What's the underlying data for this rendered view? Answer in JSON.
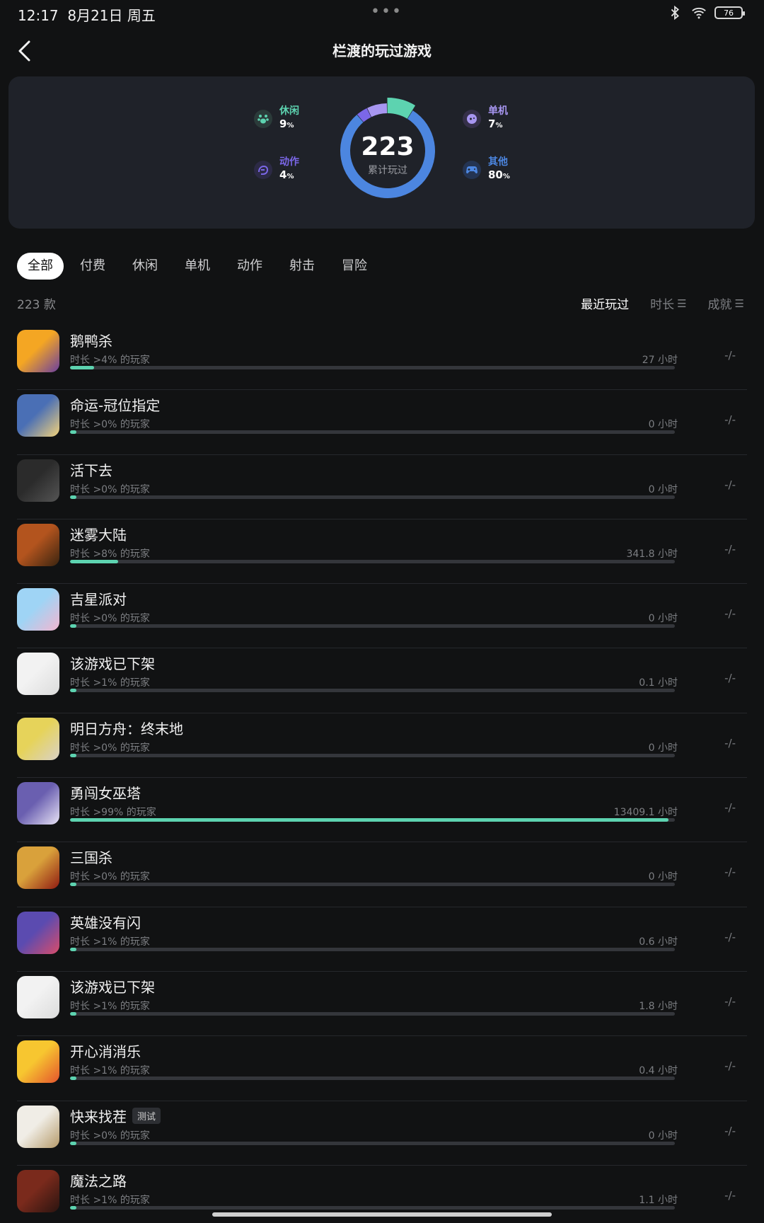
{
  "status_bar": {
    "time": "12:17",
    "date": "8月21日 周五",
    "battery": "76",
    "dots": "•••"
  },
  "header": {
    "title": "栏渡的玩过游戏",
    "back_icon": "chevron-left-icon"
  },
  "summary": {
    "total": "223",
    "total_label": "累计玩过",
    "categories": [
      {
        "name": "休闲",
        "percent": "9",
        "unit": "%",
        "color": "#5dd3b0",
        "icon": "paw-icon"
      },
      {
        "name": "动作",
        "percent": "4",
        "unit": "%",
        "color": "#7b67e8",
        "icon": "punch-icon"
      },
      {
        "name": "单机",
        "percent": "7",
        "unit": "%",
        "color": "#a796f0",
        "icon": "gamepad-icon"
      },
      {
        "name": "其他",
        "percent": "80",
        "unit": "%",
        "color": "#4c86e0",
        "icon": "controller-icon"
      }
    ]
  },
  "tabs": [
    "全部",
    "付费",
    "休闲",
    "单机",
    "动作",
    "射击",
    "冒险"
  ],
  "list_header": {
    "count": "223 款",
    "sort": [
      "最近玩过",
      "时长",
      "成就"
    ],
    "sort_glyph": "☰"
  },
  "games": [
    {
      "name": "鹅鸭杀",
      "sub": "时长 >4% 的玩家",
      "hours": "27 小时",
      "progress": 0.04,
      "ach": "-/-",
      "icon_colors": [
        "#f4a623",
        "#6b3fa0"
      ]
    },
    {
      "name": "命运-冠位指定",
      "sub": "时长 >0% 的玩家",
      "hours": "0 小时",
      "progress": 0.0,
      "ach": "-/-",
      "icon_colors": [
        "#4a6fb5",
        "#f2d27a"
      ]
    },
    {
      "name": "活下去",
      "sub": "时长 >0% 的玩家",
      "hours": "0 小时",
      "progress": 0.0,
      "ach": "-/-",
      "icon_colors": [
        "#2b2b2b",
        "#555555"
      ]
    },
    {
      "name": "迷雾大陆",
      "sub": "时长 >8% 的玩家",
      "hours": "341.8 小时",
      "progress": 0.08,
      "ach": "-/-",
      "icon_colors": [
        "#b3541e",
        "#3a2410"
      ]
    },
    {
      "name": "吉星派对",
      "sub": "时长 >0% 的玩家",
      "hours": "0 小时",
      "progress": 0.0,
      "ach": "-/-",
      "icon_colors": [
        "#9fd4f5",
        "#f3b6d0"
      ]
    },
    {
      "name": "该游戏已下架",
      "sub": "时长 >1% 的玩家",
      "hours": "0.1 小时",
      "progress": 0.01,
      "ach": "-/-",
      "icon_colors": [
        "#f2f2f2",
        "#dcdcdc"
      ]
    },
    {
      "name": "明日方舟：终末地",
      "sub": "时长 >0% 的玩家",
      "hours": "0 小时",
      "progress": 0.0,
      "ach": "-/-",
      "icon_colors": [
        "#e6d35a",
        "#d9d2c7"
      ]
    },
    {
      "name": "勇闯女巫塔",
      "sub": "时长 >99% 的玩家",
      "hours": "13409.1 小时",
      "progress": 0.99,
      "ach": "-/-",
      "icon_colors": [
        "#6a5fb0",
        "#e8e3f5"
      ]
    },
    {
      "name": "三国杀",
      "sub": "时长 >0% 的玩家",
      "hours": "0 小时",
      "progress": 0.0,
      "ach": "-/-",
      "icon_colors": [
        "#d9a13b",
        "#8f1b12"
      ]
    },
    {
      "name": "英雄没有闪",
      "sub": "时长 >1% 的玩家",
      "hours": "0.6 小时",
      "progress": 0.01,
      "ach": "-/-",
      "icon_colors": [
        "#5b4bb0",
        "#d94d6a"
      ]
    },
    {
      "name": "该游戏已下架",
      "sub": "时长 >1% 的玩家",
      "hours": "1.8 小时",
      "progress": 0.01,
      "ach": "-/-",
      "icon_colors": [
        "#f2f2f2",
        "#dcdcdc"
      ]
    },
    {
      "name": "开心消消乐",
      "sub": "时长 >1% 的玩家",
      "hours": "0.4 小时",
      "progress": 0.01,
      "ach": "-/-",
      "icon_colors": [
        "#f7c630",
        "#e4542d"
      ]
    },
    {
      "name": "快来找茬",
      "badge": "测试",
      "sub": "时长 >0% 的玩家",
      "hours": "0 小时",
      "progress": 0.0,
      "ach": "-/-",
      "icon_colors": [
        "#f0ede6",
        "#b59a6a"
      ]
    },
    {
      "name": "魔法之路",
      "sub": "时长 >1% 的玩家",
      "hours": "1.1 小时",
      "progress": 0.01,
      "ach": "-/-",
      "icon_colors": [
        "#7a2a1c",
        "#2a1410"
      ]
    }
  ]
}
